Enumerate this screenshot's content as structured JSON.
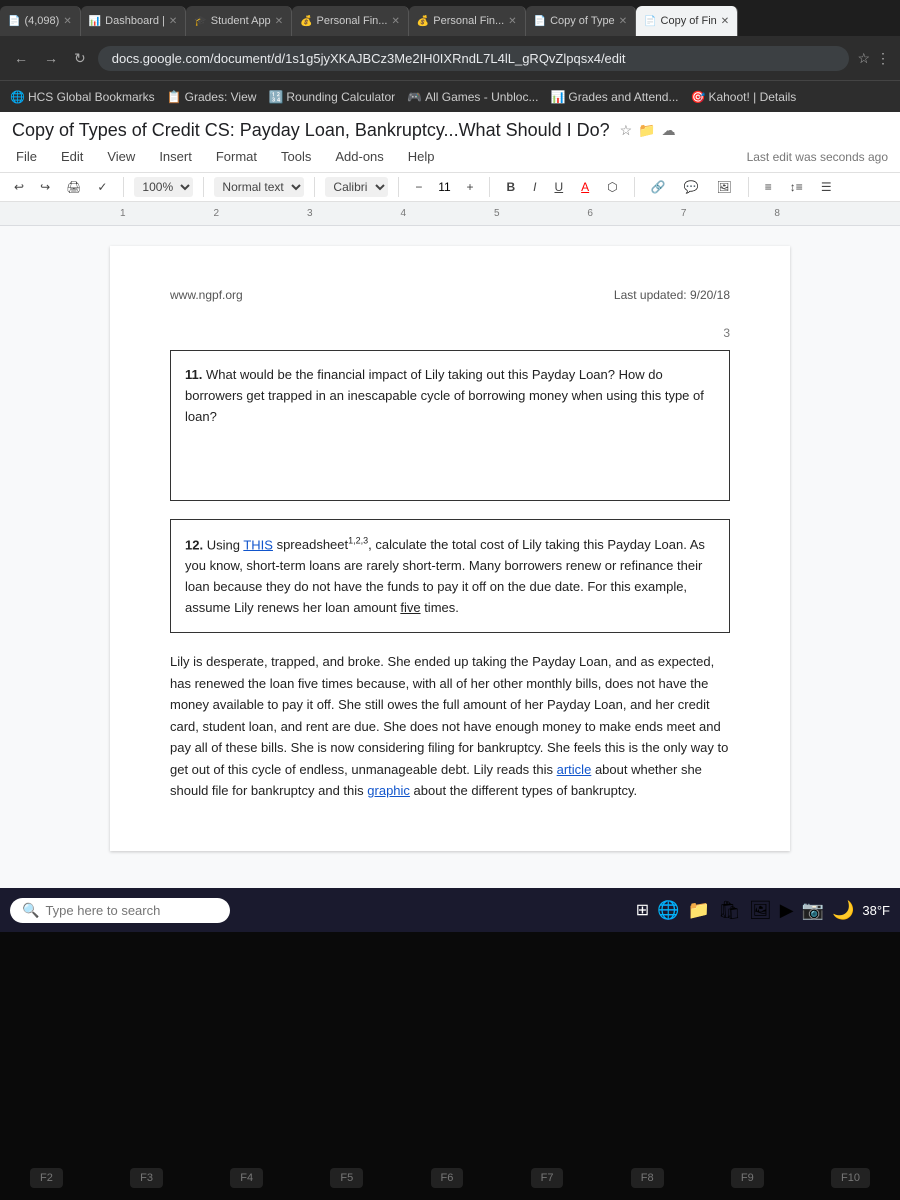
{
  "browser": {
    "tabs": [
      {
        "id": "tab1",
        "label": "(4,098)",
        "icon": "📄",
        "active": false,
        "closeable": true
      },
      {
        "id": "tab2",
        "label": "Dashboard |",
        "icon": "📊",
        "active": false,
        "closeable": true
      },
      {
        "id": "tab3",
        "label": "Student App",
        "icon": "🎓",
        "active": false,
        "closeable": true
      },
      {
        "id": "tab4",
        "label": "Personal Fin...",
        "icon": "💰",
        "active": false,
        "closeable": true
      },
      {
        "id": "tab5",
        "label": "Personal Fin...",
        "icon": "💰",
        "active": false,
        "closeable": true
      },
      {
        "id": "tab6",
        "label": "Copy of Type",
        "icon": "📄",
        "active": false,
        "closeable": true
      },
      {
        "id": "tab7",
        "label": "Copy of Fin",
        "icon": "📄",
        "active": true,
        "closeable": true
      }
    ],
    "address": "docs.google.com/document/d/1s1g5jyXKAJBCz3Me2IH0IXRndL7L4lL_gRQvZlpqsx4/edit",
    "bookmarks": [
      {
        "label": "HCS Global Bookmarks"
      },
      {
        "label": "Grades: View"
      },
      {
        "label": "Rounding Calculator"
      },
      {
        "label": "All Games - Unbloc..."
      },
      {
        "label": "Grades and Attend..."
      },
      {
        "label": "Kahoot! | Details"
      }
    ]
  },
  "document": {
    "title": "Copy of Types of Credit CS: Payday Loan, Bankruptcy...What Should I Do?",
    "last_edit": "Last edit was seconds ago",
    "toolbar": {
      "zoom": "100%",
      "style": "Normal text",
      "font": "Calibri",
      "size": "11",
      "bold": "B",
      "italic": "I",
      "underline": "U",
      "strikethrough": "A"
    },
    "ruler_marks": [
      "1",
      "2",
      "3",
      "4",
      "5",
      "6",
      "7",
      "8"
    ],
    "header_left": "www.ngpf.org",
    "header_right": "Last updated: 9/20/18",
    "page_number": "3",
    "question11": {
      "number": "11.",
      "text": "What would be the financial impact of Lily taking out this Payday Loan?  How do borrowers get trapped in an inescapable cycle of borrowing money when using this type of loan?"
    },
    "question12": {
      "number": "12.",
      "text_before": "Using ",
      "link_text": "THIS",
      "text_after": " spreadsheet",
      "superscripts": "1,2,3",
      "text_rest": ", calculate the total cost of Lily taking this Payday Loan.  As you know, short-term loans are rarely short-term.  Many borrowers renew or refinance their loan because they do not have the funds to pay it off on the due date.  For this example, assume Lily renews her loan amount five times."
    },
    "body_paragraph": "Lily is desperate, trapped, and broke. She ended up taking the Payday Loan, and as expected, has renewed the loan five times because, with all of her other monthly bills, does not have the money available to pay it off. She still owes the full amount of her Payday Loan, and her credit card, student loan, and rent are due. She does not have enough money to make ends meet and pay all of these bills. She is now considering filing for bankruptcy. She feels this is the only way to get out of this cycle of endless, unmanageable debt. Lily reads this ",
    "article_link": "article",
    "body_paragraph_end": " about whether she should file for bankruptcy and this ",
    "graphic_link": "graphic",
    "body_paragraph_final": " about the different types of bankruptcy."
  },
  "taskbar": {
    "search_placeholder": "Type here to search",
    "weather": "38°F",
    "time": "38°F"
  },
  "fn_keys": [
    "F2",
    "F3",
    "F4",
    "F5",
    "F6",
    "F7",
    "F8",
    "F9",
    "F10"
  ]
}
